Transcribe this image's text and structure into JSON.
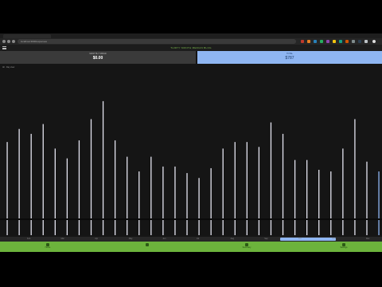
{
  "browser": {
    "url": "localhost:3000/expenses"
  },
  "app": {
    "title": "THIRTY MONTH MEDIAN BLOG",
    "cards": {
      "left": {
        "label": "MONTHLY SPEND",
        "value": "$0.00"
      },
      "right": {
        "label": "TOTAL",
        "value": "$787"
      }
    },
    "caption": "All · Day view",
    "scrub_labels": [
      "Feb",
      "Mar",
      "Apr",
      "May",
      "Jun",
      "Jul",
      "Aug",
      "Sep",
      "Oct",
      "Nov",
      "Dec"
    ],
    "nav": [
      "Home",
      "",
      "Summary",
      "Settings"
    ]
  },
  "colors": {
    "accent": "#8fb6f2",
    "nav": "#6cb33c",
    "bar": "#e4e4f0"
  },
  "chart_data": {
    "type": "bar",
    "values": [
      57,
      65,
      62,
      68,
      53,
      47,
      58,
      71,
      82,
      58,
      48,
      39,
      48,
      42,
      42,
      38,
      35,
      41,
      53,
      57,
      57,
      54,
      69,
      62,
      46,
      46,
      40,
      39,
      53,
      71,
      45,
      39
    ],
    "ylim": [
      0,
      100
    ]
  }
}
